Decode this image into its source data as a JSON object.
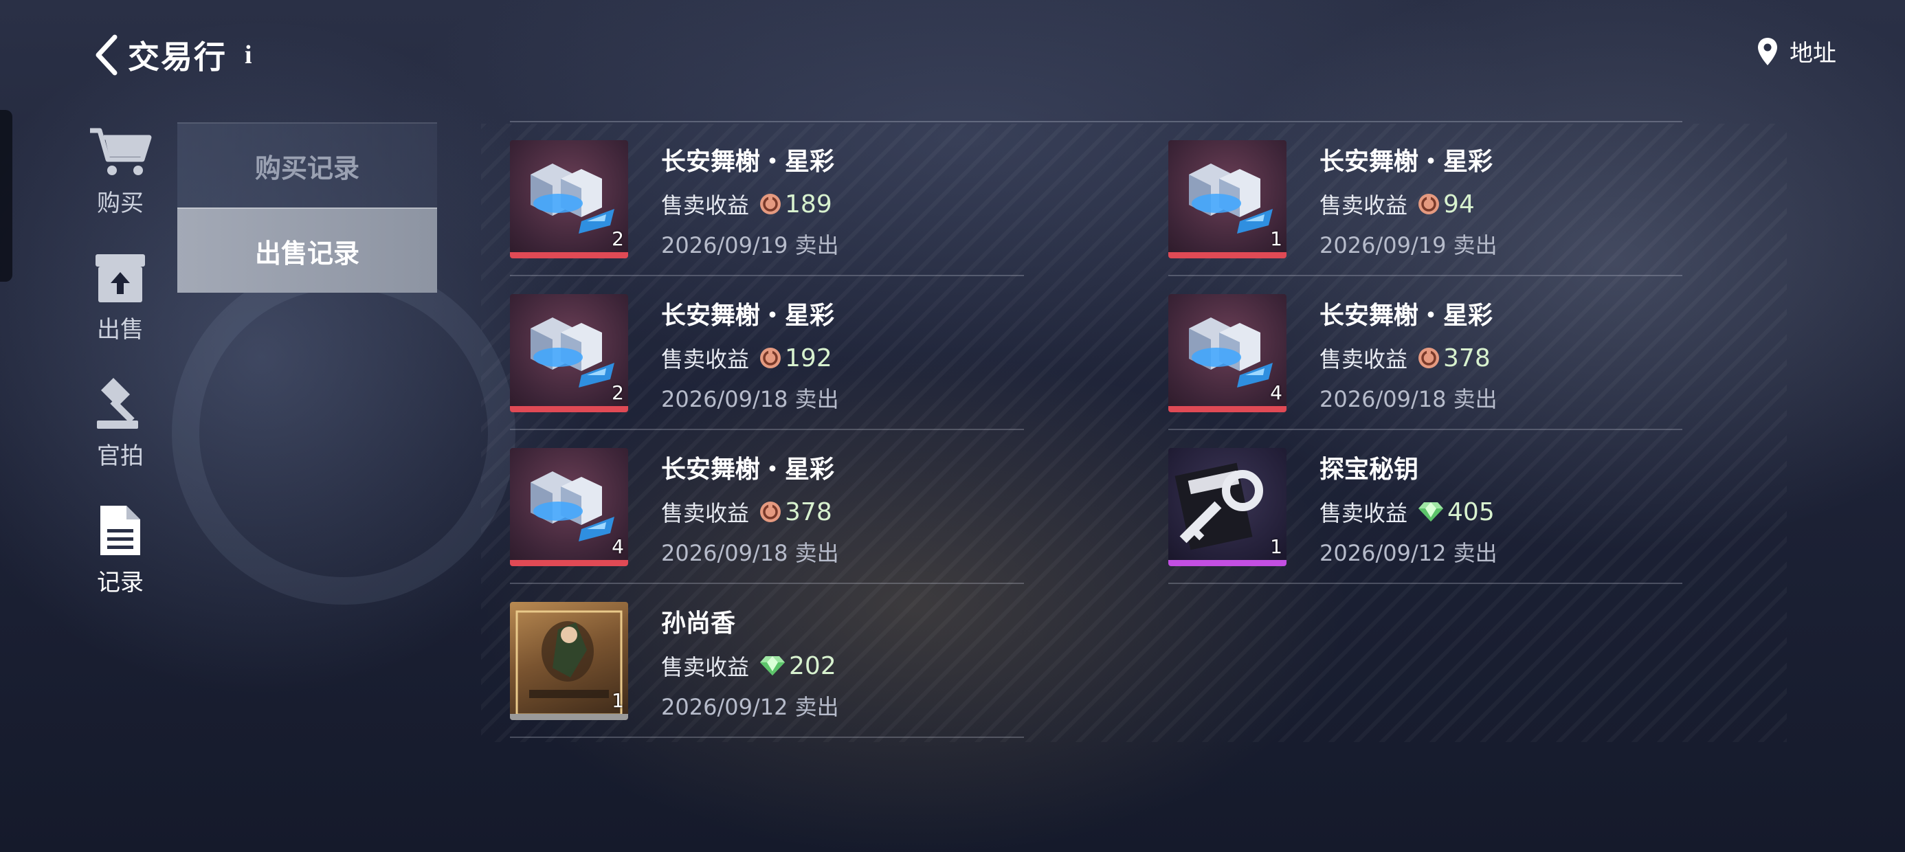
{
  "header": {
    "title": "交易行",
    "info_label": "i",
    "address_label": "地址"
  },
  "nav": [
    {
      "label": "购买",
      "icon": "cart-icon"
    },
    {
      "label": "出售",
      "icon": "upload-box-icon"
    },
    {
      "label": "官拍",
      "icon": "auction-hammer-icon"
    },
    {
      "label": "记录",
      "icon": "document-icon",
      "active": true
    }
  ],
  "subtabs": [
    {
      "label": "购买记录",
      "active": false
    },
    {
      "label": "出售记录",
      "active": true
    }
  ],
  "earn_label": "售卖收益",
  "records": [
    {
      "name": "长安舞榭・星彩",
      "earning": "189",
      "currency": "coupon-coin-icon",
      "date": "2026/09/19 卖出",
      "qty": "2",
      "rarity_color": "#e04a55"
    },
    {
      "name": "长安舞榭・星彩",
      "earning": "94",
      "currency": "coupon-coin-icon",
      "date": "2026/09/19 卖出",
      "qty": "1",
      "rarity_color": "#e04a55"
    },
    {
      "name": "长安舞榭・星彩",
      "earning": "192",
      "currency": "coupon-coin-icon",
      "date": "2026/09/18 卖出",
      "qty": "2",
      "rarity_color": "#e04a55"
    },
    {
      "name": "长安舞榭・星彩",
      "earning": "378",
      "currency": "coupon-coin-icon",
      "date": "2026/09/18 卖出",
      "qty": "4",
      "rarity_color": "#e04a55"
    },
    {
      "name": "长安舞榭・星彩",
      "earning": "378",
      "currency": "coupon-coin-icon",
      "date": "2026/09/18 卖出",
      "qty": "4",
      "rarity_color": "#e04a55"
    },
    {
      "name": "探宝秘钥",
      "earning": "405",
      "currency": "green-diamond-icon",
      "date": "2026/09/12 卖出",
      "qty": "1",
      "rarity_color": "#c34fe2"
    },
    {
      "name": "孙尚香",
      "earning": "202",
      "currency": "green-diamond-icon",
      "date": "2026/09/12 卖出",
      "qty": "1",
      "rarity_color": "#9a9a9a"
    }
  ]
}
